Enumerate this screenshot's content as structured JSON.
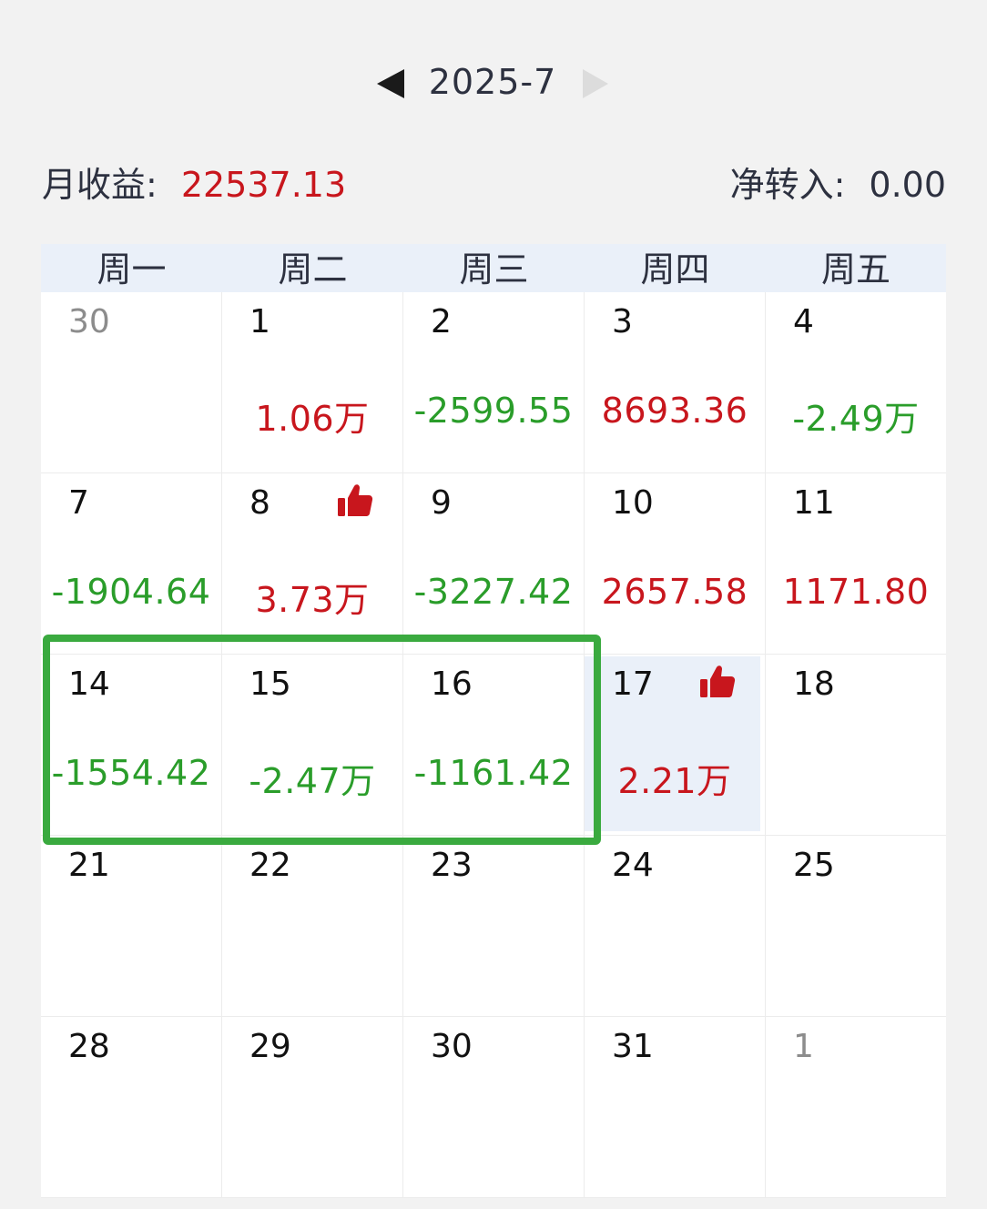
{
  "header": {
    "month": "2025-7"
  },
  "summary": {
    "monthly_income_label": "月收益:",
    "monthly_income_value": "22537.13",
    "net_transfer_label": "净转入:",
    "net_transfer_value": "0.00"
  },
  "colors": {
    "positive": "#c8161d",
    "negative": "#2a9d2a",
    "highlight": "#eaf0f9",
    "selection": "#3aaa3f"
  },
  "weekdays": [
    "周一",
    "周二",
    "周三",
    "周四",
    "周五"
  ],
  "weeks": [
    [
      {
        "day": "30",
        "pnl": "",
        "sign": "",
        "other_month": true,
        "thumb": false
      },
      {
        "day": "1",
        "pnl": "1.06万",
        "sign": "pos",
        "other_month": false,
        "thumb": false
      },
      {
        "day": "2",
        "pnl": "-2599.55",
        "sign": "neg",
        "other_month": false,
        "thumb": false
      },
      {
        "day": "3",
        "pnl": "8693.36",
        "sign": "pos",
        "other_month": false,
        "thumb": false
      },
      {
        "day": "4",
        "pnl": "-2.49万",
        "sign": "neg",
        "other_month": false,
        "thumb": false
      }
    ],
    [
      {
        "day": "7",
        "pnl": "-1904.64",
        "sign": "neg",
        "other_month": false,
        "thumb": false
      },
      {
        "day": "8",
        "pnl": "3.73万",
        "sign": "pos",
        "other_month": false,
        "thumb": true
      },
      {
        "day": "9",
        "pnl": "-3227.42",
        "sign": "neg",
        "other_month": false,
        "thumb": false
      },
      {
        "day": "10",
        "pnl": "2657.58",
        "sign": "pos",
        "other_month": false,
        "thumb": false
      },
      {
        "day": "11",
        "pnl": "1171.80",
        "sign": "pos",
        "other_month": false,
        "thumb": false
      }
    ],
    [
      {
        "day": "14",
        "pnl": "-1554.42",
        "sign": "neg",
        "other_month": false,
        "thumb": false
      },
      {
        "day": "15",
        "pnl": "-2.47万",
        "sign": "neg",
        "other_month": false,
        "thumb": false
      },
      {
        "day": "16",
        "pnl": "-1161.42",
        "sign": "neg",
        "other_month": false,
        "thumb": false
      },
      {
        "day": "17",
        "pnl": "2.21万",
        "sign": "pos",
        "other_month": false,
        "thumb": true,
        "today": true
      },
      {
        "day": "18",
        "pnl": "",
        "sign": "",
        "other_month": false,
        "thumb": false
      }
    ],
    [
      {
        "day": "21",
        "pnl": "",
        "sign": "",
        "other_month": false,
        "thumb": false
      },
      {
        "day": "22",
        "pnl": "",
        "sign": "",
        "other_month": false,
        "thumb": false
      },
      {
        "day": "23",
        "pnl": "",
        "sign": "",
        "other_month": false,
        "thumb": false
      },
      {
        "day": "24",
        "pnl": "",
        "sign": "",
        "other_month": false,
        "thumb": false
      },
      {
        "day": "25",
        "pnl": "",
        "sign": "",
        "other_month": false,
        "thumb": false
      }
    ],
    [
      {
        "day": "28",
        "pnl": "",
        "sign": "",
        "other_month": false,
        "thumb": false
      },
      {
        "day": "29",
        "pnl": "",
        "sign": "",
        "other_month": false,
        "thumb": false
      },
      {
        "day": "30",
        "pnl": "",
        "sign": "",
        "other_month": false,
        "thumb": false
      },
      {
        "day": "31",
        "pnl": "",
        "sign": "",
        "other_month": false,
        "thumb": false
      },
      {
        "day": "1",
        "pnl": "",
        "sign": "",
        "other_month": true,
        "thumb": false
      }
    ]
  ]
}
